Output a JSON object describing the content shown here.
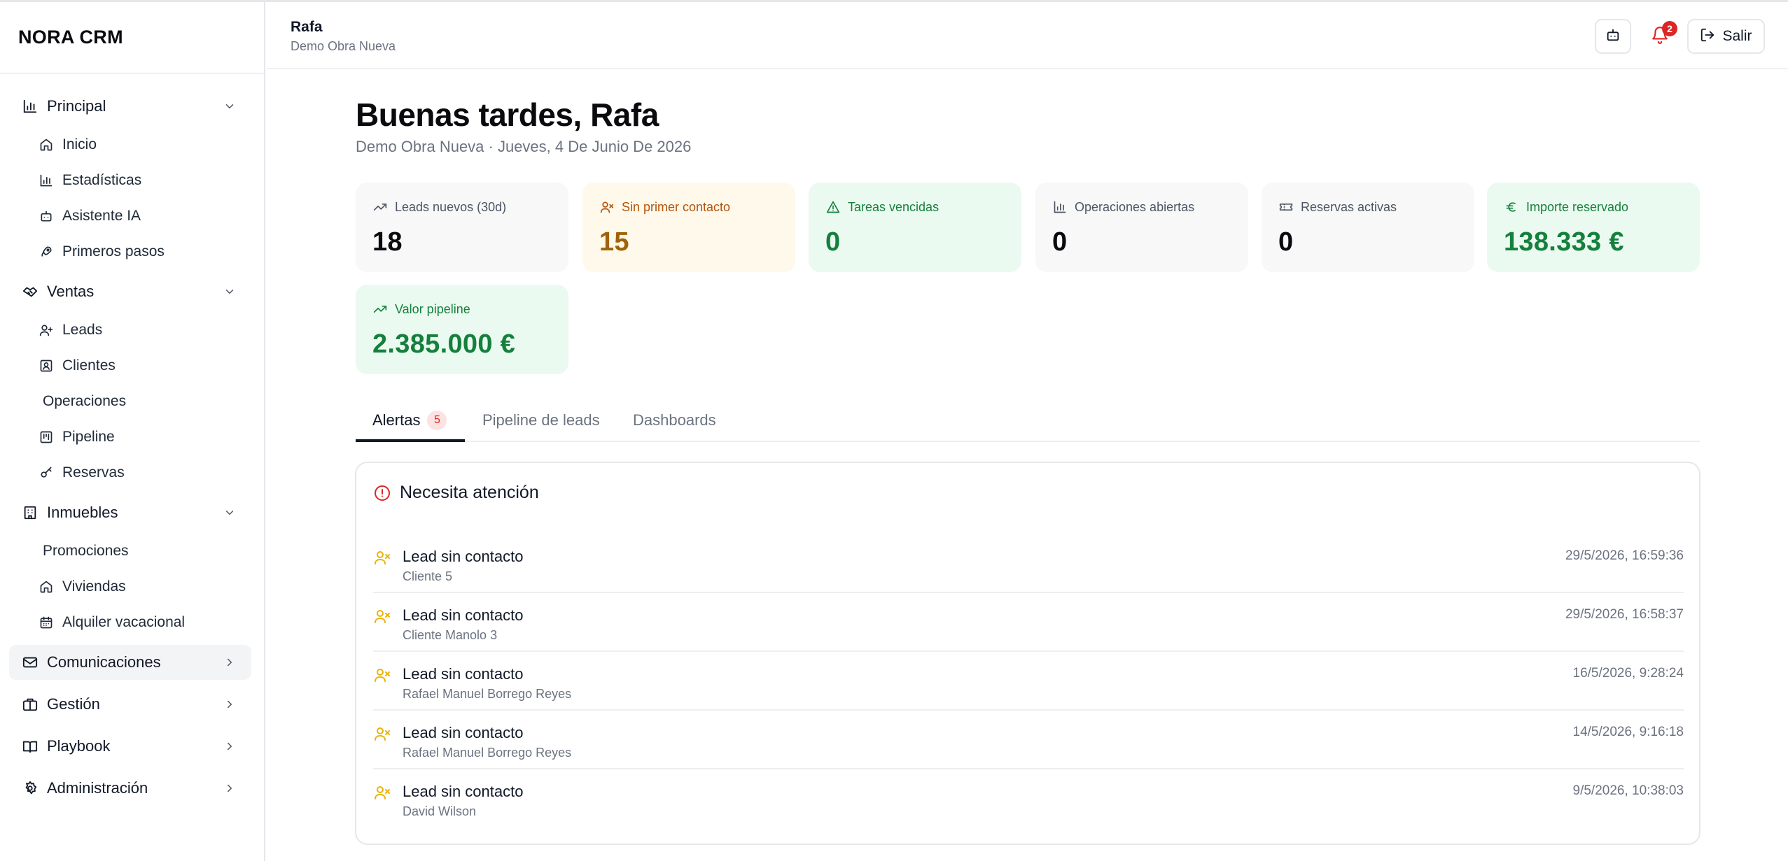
{
  "app": {
    "brand": "NORA CRM"
  },
  "sidebar": {
    "sections": [
      {
        "label": "Principal",
        "icon": "bar-chart-icon",
        "expanded": true,
        "items": [
          {
            "label": "Inicio",
            "icon": "home-icon"
          },
          {
            "label": "Estadísticas",
            "icon": "bar-chart-icon"
          },
          {
            "label": "Asistente IA",
            "icon": "bot-icon"
          },
          {
            "label": "Primeros pasos",
            "icon": "rocket-icon"
          }
        ]
      },
      {
        "label": "Ventas",
        "icon": "handshake-icon",
        "expanded": true,
        "items": [
          {
            "label": "Leads",
            "icon": "user-plus-icon"
          },
          {
            "label": "Clientes",
            "icon": "contact-icon"
          },
          {
            "label": "Operaciones",
            "icon": ""
          },
          {
            "label": "Pipeline",
            "icon": "kanban-icon"
          },
          {
            "label": "Reservas",
            "icon": "key-icon"
          }
        ]
      },
      {
        "label": "Inmuebles",
        "icon": "building-icon",
        "expanded": true,
        "items": [
          {
            "label": "Promociones",
            "icon": ""
          },
          {
            "label": "Viviendas",
            "icon": "home-icon"
          },
          {
            "label": "Alquiler vacacional",
            "icon": "calendar-icon"
          }
        ]
      },
      {
        "label": "Comunicaciones",
        "icon": "mail-icon",
        "expanded": false
      },
      {
        "label": "Gestión",
        "icon": "briefcase-icon",
        "expanded": false
      },
      {
        "label": "Playbook",
        "icon": "book-icon",
        "expanded": false
      },
      {
        "label": "Administración",
        "icon": "gear-icon",
        "expanded": false
      }
    ]
  },
  "header": {
    "user_name": "Rafa",
    "org": "Demo Obra Nueva",
    "notifications_count": "2",
    "logout_label": "Salir"
  },
  "main": {
    "greeting": "Buenas tardes, Rafa",
    "subtitle": "Demo Obra Nueva · Jueves, 4 De Junio De 2026",
    "kpis": [
      {
        "label": "Leads nuevos (30d)",
        "value": "18",
        "tone": "gray",
        "icon": "trending-up-icon"
      },
      {
        "label": "Sin primer contacto",
        "value": "15",
        "tone": "yellow",
        "icon": "user-x-icon"
      },
      {
        "label": "Tareas vencidas",
        "value": "0",
        "tone": "green",
        "icon": "alert-triangle-icon"
      },
      {
        "label": "Operaciones abiertas",
        "value": "0",
        "tone": "gray",
        "icon": "bar-chart-icon"
      },
      {
        "label": "Reservas activas",
        "value": "0",
        "tone": "gray",
        "icon": "ticket-icon"
      },
      {
        "label": "Importe reservado",
        "value": "138.333 €",
        "tone": "green",
        "icon": "euro-icon"
      },
      {
        "label": "Valor pipeline",
        "value": "2.385.000 €",
        "tone": "green",
        "icon": "trending-up-icon"
      }
    ],
    "tabs": [
      {
        "label": "Alertas",
        "badge": "5",
        "active": true
      },
      {
        "label": "Pipeline de leads",
        "active": false
      },
      {
        "label": "Dashboards",
        "active": false
      }
    ],
    "alerts_panel": {
      "title": "Necesita atención",
      "alerts": [
        {
          "title": "Lead sin contacto",
          "subtitle": "Cliente 5",
          "time": "29/5/2026, 16:59:36"
        },
        {
          "title": "Lead sin contacto",
          "subtitle": "Cliente Manolo 3",
          "time": "29/5/2026, 16:58:37"
        },
        {
          "title": "Lead sin contacto",
          "subtitle": "Rafael Manuel Borrego Reyes",
          "time": "16/5/2026, 9:28:24"
        },
        {
          "title": "Lead sin contacto",
          "subtitle": "Rafael Manuel Borrego Reyes",
          "time": "14/5/2026, 9:16:18"
        },
        {
          "title": "Lead sin contacto",
          "subtitle": "David Wilson",
          "time": "9/5/2026, 10:38:03"
        }
      ]
    }
  },
  "colors": {
    "accent_green": "#15803d",
    "warning_yellow": "#b45309",
    "danger_red": "#dc2626"
  }
}
